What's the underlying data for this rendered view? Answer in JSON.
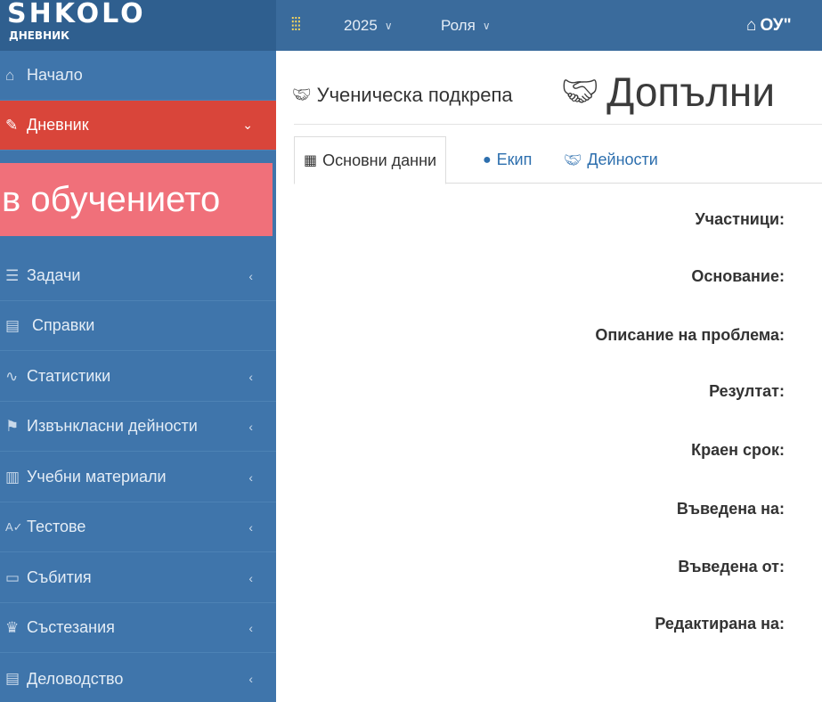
{
  "header": {
    "logo_word": "SHKOLO",
    "logo_sub": "ДНЕВНИК",
    "apps_icon": "grid-icon",
    "year_label": "2025",
    "role_label": "Роля",
    "school_label": "ОУ\""
  },
  "sidebar": {
    "items": [
      {
        "label": "Начало",
        "icon": "home-icon",
        "has_arrow": false
      },
      {
        "label": "Дневник",
        "icon": "edit-icon",
        "has_arrow": true,
        "active": true
      },
      {
        "label": "Задачи",
        "icon": "tasks-icon",
        "has_arrow": true
      },
      {
        "label": "Справки",
        "icon": "report-icon",
        "has_arrow": false
      },
      {
        "label": "Статистики",
        "icon": "chart-icon",
        "has_arrow": true
      },
      {
        "label": "Извънкласни дейности",
        "icon": "running-icon",
        "has_arrow": true
      },
      {
        "label": "Учебни материали",
        "icon": "books-icon",
        "has_arrow": true
      },
      {
        "label": "Тестове",
        "icon": "spellcheck-icon",
        "has_arrow": true
      },
      {
        "label": "Събития",
        "icon": "calendar-icon",
        "has_arrow": true
      },
      {
        "label": "Състезания",
        "icon": "trophy-icon",
        "has_arrow": true
      },
      {
        "label": "Деловодство",
        "icon": "document-icon",
        "has_arrow": true
      }
    ],
    "zoomed_highlight": "в обучението"
  },
  "main": {
    "page_title": "Ученическа подкрепа ",
    "zoomed_title": "Допълни",
    "tabs": [
      {
        "label": "Основни данни",
        "icon": "grid-icon",
        "active": true
      },
      {
        "label": "Екип",
        "icon": "user-icon",
        "active": false
      },
      {
        "label": "Дейности",
        "icon": "handshake-icon",
        "active": false
      }
    ],
    "fields": [
      {
        "label": "Участници:"
      },
      {
        "label": "Основание:"
      },
      {
        "label": "Описание на проблема:"
      },
      {
        "label": "Резултат:"
      },
      {
        "label": "Краен срок:"
      },
      {
        "label": "Въведена на:"
      },
      {
        "label": "Въведена от:"
      },
      {
        "label": "Редактирана на:"
      }
    ]
  },
  "colors": {
    "topbar": "#3a6b9c",
    "sidebar": "#3f75ab",
    "active_item": "#d9453a",
    "highlight": "#f0707a",
    "link": "#2d6fae"
  }
}
